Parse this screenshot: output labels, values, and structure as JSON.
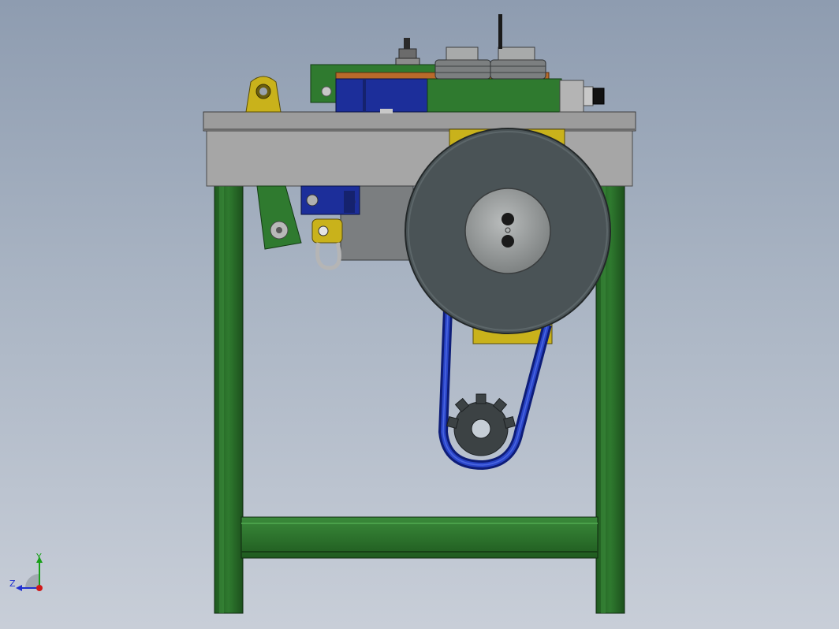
{
  "view": {
    "background_top": "#8e9cb0",
    "background_bottom": "#c8ced8"
  },
  "model": {
    "frame_color": "#2d6e2d",
    "table_color": "#a3a3a3",
    "wheel_color": "#4a5356",
    "belt_color": "#2238a8",
    "motor_color": "#1c2e9a",
    "bracket_color": "#c9b21b"
  },
  "triad": {
    "y_label": "Y",
    "z_label": "Z",
    "y_color": "#18a018",
    "z_color": "#2030d0",
    "x_color": "#d01818"
  }
}
